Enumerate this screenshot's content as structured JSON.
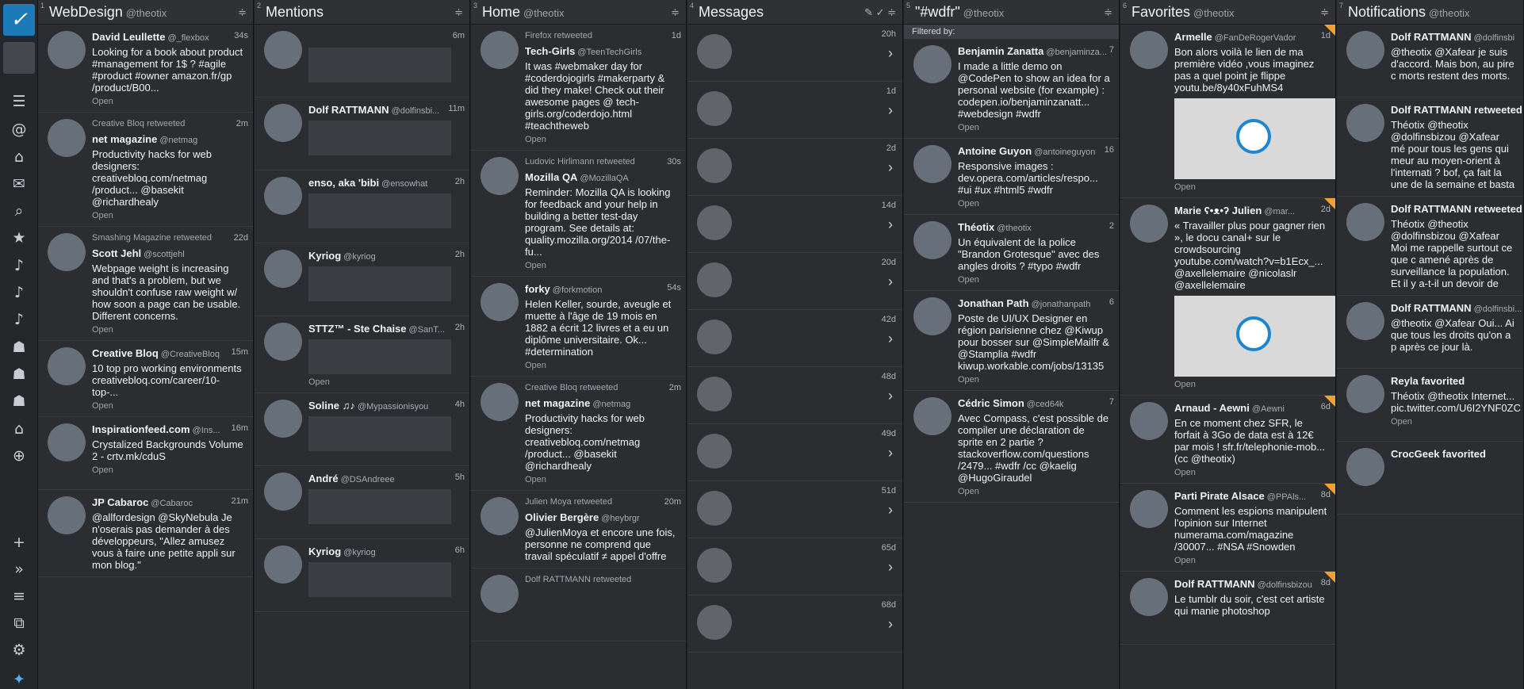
{
  "sidebar": {
    "logo": "✓",
    "icons": [
      "home-icon",
      "at-icon",
      "home-outline-icon",
      "mail-icon",
      "search-icon",
      "star-icon",
      "bell-icon",
      "bell-icon",
      "bell-icon",
      "user-icon",
      "user-icon",
      "user-icon",
      "home-icon",
      "add-icon",
      "expand-icon",
      "filter-icon",
      "stack-icon",
      "gear-icon",
      "twitter-icon"
    ]
  },
  "columns": [
    {
      "num": "1",
      "title": "WebDesign",
      "owner": "@theotix",
      "tweets": [
        {
          "author": "David Leullette",
          "handle": "@_flexbox",
          "time": "34s",
          "rt": "",
          "text": "Looking for a book about product #management for 1$ ? #agile #product #owner amazon.fr/gp /product/B00...",
          "open": "Open"
        },
        {
          "author": "net magazine",
          "handle": "@netmag",
          "time": "2m",
          "rt": "Creative Bloq retweeted",
          "text": "Productivity hacks for web designers: creativebloq.com/netmag /product... @basekit @richardhealy",
          "open": "Open"
        },
        {
          "author": "Scott Jehl",
          "handle": "@scottjehl",
          "time": "22d",
          "rt": "Smashing Magazine retweeted",
          "text": "Webpage weight is increasing and that's a problem, but we shouldn't confuse raw weight w/ how soon a page can be usable. Different concerns.",
          "open": "Open"
        },
        {
          "author": "Creative Bloq",
          "handle": "@CreativeBloq",
          "time": "15m",
          "rt": "",
          "text": "10 top pro working environments creativebloq.com/career/10-top-...",
          "open": "Open"
        },
        {
          "author": "Inspirationfeed.com",
          "handle": "@Ins...",
          "time": "16m",
          "rt": "",
          "text": "Crystalized Backgrounds Volume 2 - crtv.mk/cduS",
          "open": "Open"
        },
        {
          "author": "JP Cabaroc",
          "handle": "@Cabaroc",
          "time": "21m",
          "rt": "",
          "text": "@allfordesign @SkyNebula Je n'oserais pas demander à des développeurs, \"Allez amusez vous à faire une petite appli sur mon blog.\"",
          "open": ""
        }
      ]
    },
    {
      "num": "2",
      "title": "Mentions",
      "owner": "",
      "tweets": [
        {
          "author": "",
          "handle": "",
          "time": "6m",
          "rt": "",
          "text": "",
          "open": ""
        },
        {
          "author": "Dolf RATTMANN",
          "handle": "@dolfinsbi...",
          "time": "11m",
          "rt": "",
          "text": "",
          "open": ""
        },
        {
          "author": "enso, aka 'bibi",
          "handle": "@ensowhat",
          "time": "2h",
          "rt": "",
          "text": "",
          "open": ""
        },
        {
          "author": "Kyriog",
          "handle": "@kyriog",
          "time": "2h",
          "rt": "",
          "text": "",
          "open": ""
        },
        {
          "author": "STTZ™ - Ste Chaise",
          "handle": "@SanT...",
          "time": "2h",
          "rt": "",
          "text": "",
          "open": "Open"
        },
        {
          "author": "Soline ♫♪",
          "handle": "@Mypassionisyou",
          "time": "4h",
          "rt": "",
          "text": "",
          "open": ""
        },
        {
          "author": "André",
          "handle": "@DSAndreee",
          "time": "5h",
          "rt": "",
          "text": "",
          "open": ""
        },
        {
          "author": "Kyriog",
          "handle": "@kyriog",
          "time": "6h",
          "rt": "",
          "text": "",
          "open": ""
        }
      ]
    },
    {
      "num": "3",
      "title": "Home",
      "owner": "@theotix",
      "tweets": [
        {
          "author": "Tech-Girls",
          "handle": "@TeenTechGirls",
          "time": "1d",
          "rt": "Firefox retweeted",
          "text": "It was #webmaker day for #coderdojogirls #makerparty & did they make! Check out their awesome pages @ tech-girls.org/coderdojo.html #teachtheweb",
          "open": "Open"
        },
        {
          "author": "Mozilla QA",
          "handle": "@MozillaQA",
          "time": "30s",
          "rt": "Ludovic Hirlimann retweeted",
          "text": "Reminder: Mozilla QA is looking for feedback and your help in building a better test-day program. See details at: quality.mozilla.org/2014 /07/the-fu...",
          "open": "Open"
        },
        {
          "author": "forky",
          "handle": "@forkmotion",
          "time": "54s",
          "rt": "",
          "text": "Helen Keller, sourde, aveugle et muette à l'âge de 19 mois en 1882 a écrit 12 livres et a eu un diplôme universitaire. Ok... #determination",
          "open": "Open"
        },
        {
          "author": "net magazine",
          "handle": "@netmag",
          "time": "2m",
          "rt": "Creative Bloq retweeted",
          "text": "Productivity hacks for web designers: creativebloq.com/netmag /product... @basekit @richardhealy",
          "open": "Open"
        },
        {
          "author": "Olivier Bergère",
          "handle": "@heybrgr",
          "time": "20m",
          "rt": "Julien Moya retweeted",
          "text": "@JulienMoya et encore une fois, personne ne comprend que travail spéculatif ≠ appel d'offre",
          "open": ""
        },
        {
          "author": "",
          "handle": "",
          "time": "",
          "rt": "Dolf RATTMANN retweeted",
          "text": "",
          "open": ""
        }
      ]
    },
    {
      "num": "4",
      "title": "Messages",
      "owner": "",
      "rows": [
        "20h",
        "1d",
        "2d",
        "14d",
        "20d",
        "42d",
        "48d",
        "49d",
        "51d",
        "65d",
        "68d"
      ]
    },
    {
      "num": "5",
      "title": "\"#wdfr\"",
      "owner": "@theotix",
      "filtered_label": "Filtered by:",
      "tweets": [
        {
          "author": "Benjamin Zanatta",
          "handle": "@benjaminza...",
          "time": "7",
          "rt": "",
          "text": "I made a little demo on @CodePen to show an idea for a personal website (for example) : codepen.io/benjaminzanatt... #webdesign #wdfr",
          "open": "Open"
        },
        {
          "author": "Antoine Guyon",
          "handle": "@antoineguyon",
          "time": "16",
          "rt": "",
          "text": "Responsive images : dev.opera.com/articles/respo... #ui #ux #html5 #wdfr",
          "open": "Open"
        },
        {
          "author": "Théotix",
          "handle": "@theotix",
          "time": "2",
          "rt": "",
          "text": "Un équivalent de la police \"Brandon Grotesque\" avec des angles droits ? #typo #wdfr",
          "open": "Open"
        },
        {
          "author": "Jonathan Path",
          "handle": "@jonathanpath",
          "time": "6",
          "rt": "",
          "text": "Poste de UI/UX Designer en région parisienne chez @Kiwup pour bosser sur @SimpleMailfr & @Stamplia #wdfr kiwup.workable.com/jobs/13135",
          "open": "Open"
        },
        {
          "author": "Cédric Simon",
          "handle": "@ced64k",
          "time": "7",
          "rt": "",
          "text": "Avec Compass, c'est possible de compiler une déclaration de sprite en 2 partie ? stackoverflow.com/questions /2479... #wdfr /cc @kaelig @HugoGiraudel",
          "open": "Open"
        }
      ]
    },
    {
      "num": "6",
      "title": "Favorites",
      "owner": "@theotix",
      "tweets": [
        {
          "author": "Armelle",
          "handle": "@FanDeRogerVador",
          "time": "1d",
          "rt": "",
          "text": "Bon alors voilà le lien de ma première vidéo ,vous imaginez pas a quel point je flippe youtu.be/8y40xFuhMS4",
          "open": "Open"
        },
        {
          "author": "Marie ʕ•ᴥ•ʔ Julien",
          "handle": "@mar...",
          "time": "2d",
          "rt": "",
          "text": "« Travailler plus pour gagner rien », le docu canal+ sur le crowdsourcing youtube.com/watch?v=b1Ecx_... @axellelemaire @nicolaslr @axellelemaire",
          "open": "Open"
        },
        {
          "author": "Arnaud - Aewni",
          "handle": "@Aewni",
          "time": "6d",
          "rt": "",
          "text": "En ce moment chez SFR, le forfait à 3Go de data est à 12€ par mois ! sfr.fr/telephonie-mob... (cc @theotix)",
          "open": "Open"
        },
        {
          "author": "Parti Pirate Alsace",
          "handle": "@PPAls...",
          "time": "8d",
          "rt": "",
          "text": "Comment les espions manipulent l'opinion sur Internet numerama.com/magazine /30007... #NSA #Snowden",
          "open": "Open"
        },
        {
          "author": "Dolf RATTMANN",
          "handle": "@dolfinsbizou",
          "time": "8d",
          "rt": "",
          "text": "Le tumblr du soir, c'est cet artiste qui manie photoshop",
          "open": ""
        }
      ]
    },
    {
      "num": "7",
      "title": "Notifications",
      "owner": "@theotix",
      "tweets": [
        {
          "author": "Dolf RATTMANN",
          "handle": "@dolfinsbi",
          "time": "",
          "rt": "",
          "text": "@theotix @Xafear je suis d'accord. Mais bon, au pire c morts restent des morts.",
          "open": ""
        },
        {
          "author": "Dolf RATTMANN retweeted",
          "handle": "",
          "time": "",
          "rt": "",
          "text": "Théotix @theotix @dolfinsbizou @Xafear mé pour tous les gens qui meur au moyen-orient à l'internati ? bof, ça fait la une de la semaine et basta",
          "open": ""
        },
        {
          "author": "Dolf RATTMANN retweeted",
          "handle": "",
          "time": "",
          "rt": "",
          "text": "Théotix @theotix @dolfinsbizou @Xafear Moi me rappelle surtout ce que c amené après de surveillance la population. Et il y a-t-il un devoir de",
          "open": ""
        },
        {
          "author": "Dolf RATTMANN",
          "handle": "@dolfinsbi...",
          "time": "",
          "rt": "",
          "text": "@theotix @Xafear Oui... Ai que tous les droits qu'on a p après ce jour là.",
          "open": ""
        },
        {
          "author": "Reyla favorited",
          "handle": "",
          "time": "",
          "rt": "",
          "text": "Théotix @theotix Internet... pic.twitter.com/U6I2YNF0ZC",
          "open": "Open"
        },
        {
          "author": "CrocGeek favorited",
          "handle": "",
          "time": "",
          "rt": "",
          "text": "",
          "open": ""
        }
      ]
    }
  ]
}
